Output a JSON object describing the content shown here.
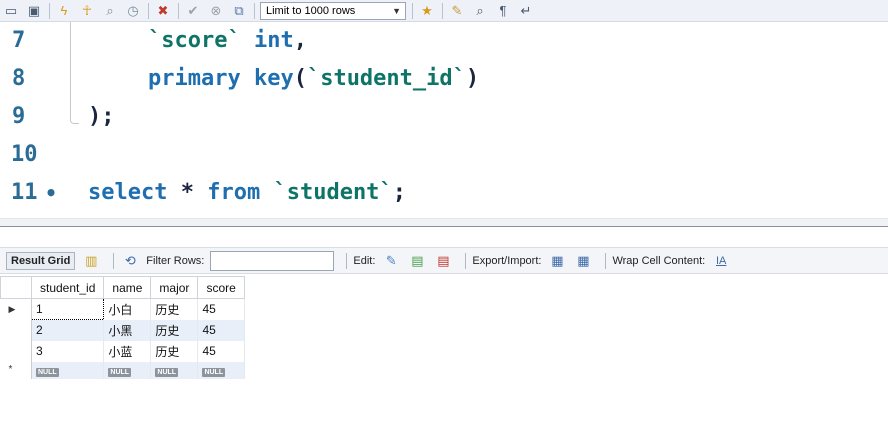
{
  "toolbar": {
    "icons": [
      "folder-open-icon",
      "save-icon",
      "execute-icon",
      "execute-current-icon",
      "explain-icon",
      "stop-icon",
      "toggle-error-icon",
      "commit-icon",
      "rollback-icon",
      "autocommit-icon"
    ],
    "limit_select": "Limit to 1000 rows",
    "right_icons": [
      "add-snippet-icon",
      "beautify-icon",
      "find-icon",
      "invisible-chars-icon",
      "word-wrap-icon"
    ]
  },
  "editor": {
    "lines": [
      {
        "number": "7",
        "dot": "",
        "text": "    `score` int,"
      },
      {
        "number": "8",
        "dot": "",
        "text": "    primary key(`student_id`)"
      },
      {
        "number": "9",
        "dot": "",
        "text": ");"
      },
      {
        "number": "10",
        "dot": "",
        "text": ""
      },
      {
        "number": "11",
        "dot": "•",
        "text": "select * from `student`;"
      }
    ],
    "tokens": {
      "line7_str": "`score`",
      "line7_kw": "int",
      "line7_punct": ",",
      "line8_kw": "primary key",
      "line8_open": "(",
      "line8_str": "`student_id`",
      "line8_close": ")",
      "line9_punct": ");",
      "line11_kw1": "select",
      "line11_star": "*",
      "line11_kw2": "from",
      "line11_str": "`student`",
      "line11_end": ";"
    }
  },
  "result_bar": {
    "tab_label": "Result Grid",
    "filter_label": "Filter Rows:",
    "filter_value": "",
    "edit_label": "Edit:",
    "export_label": "Export/Import:",
    "wrap_label": "Wrap Cell Content:"
  },
  "grid": {
    "columns": [
      "student_id",
      "name",
      "major",
      "score"
    ],
    "rows": [
      [
        "1",
        "小白",
        "历史",
        "45"
      ],
      [
        "2",
        "小黑",
        "历史",
        "45"
      ],
      [
        "3",
        "小蓝",
        "历史",
        "45"
      ]
    ],
    "null_label": "NULL",
    "current_row_marker": "▶",
    "new_row_marker": "*"
  }
}
